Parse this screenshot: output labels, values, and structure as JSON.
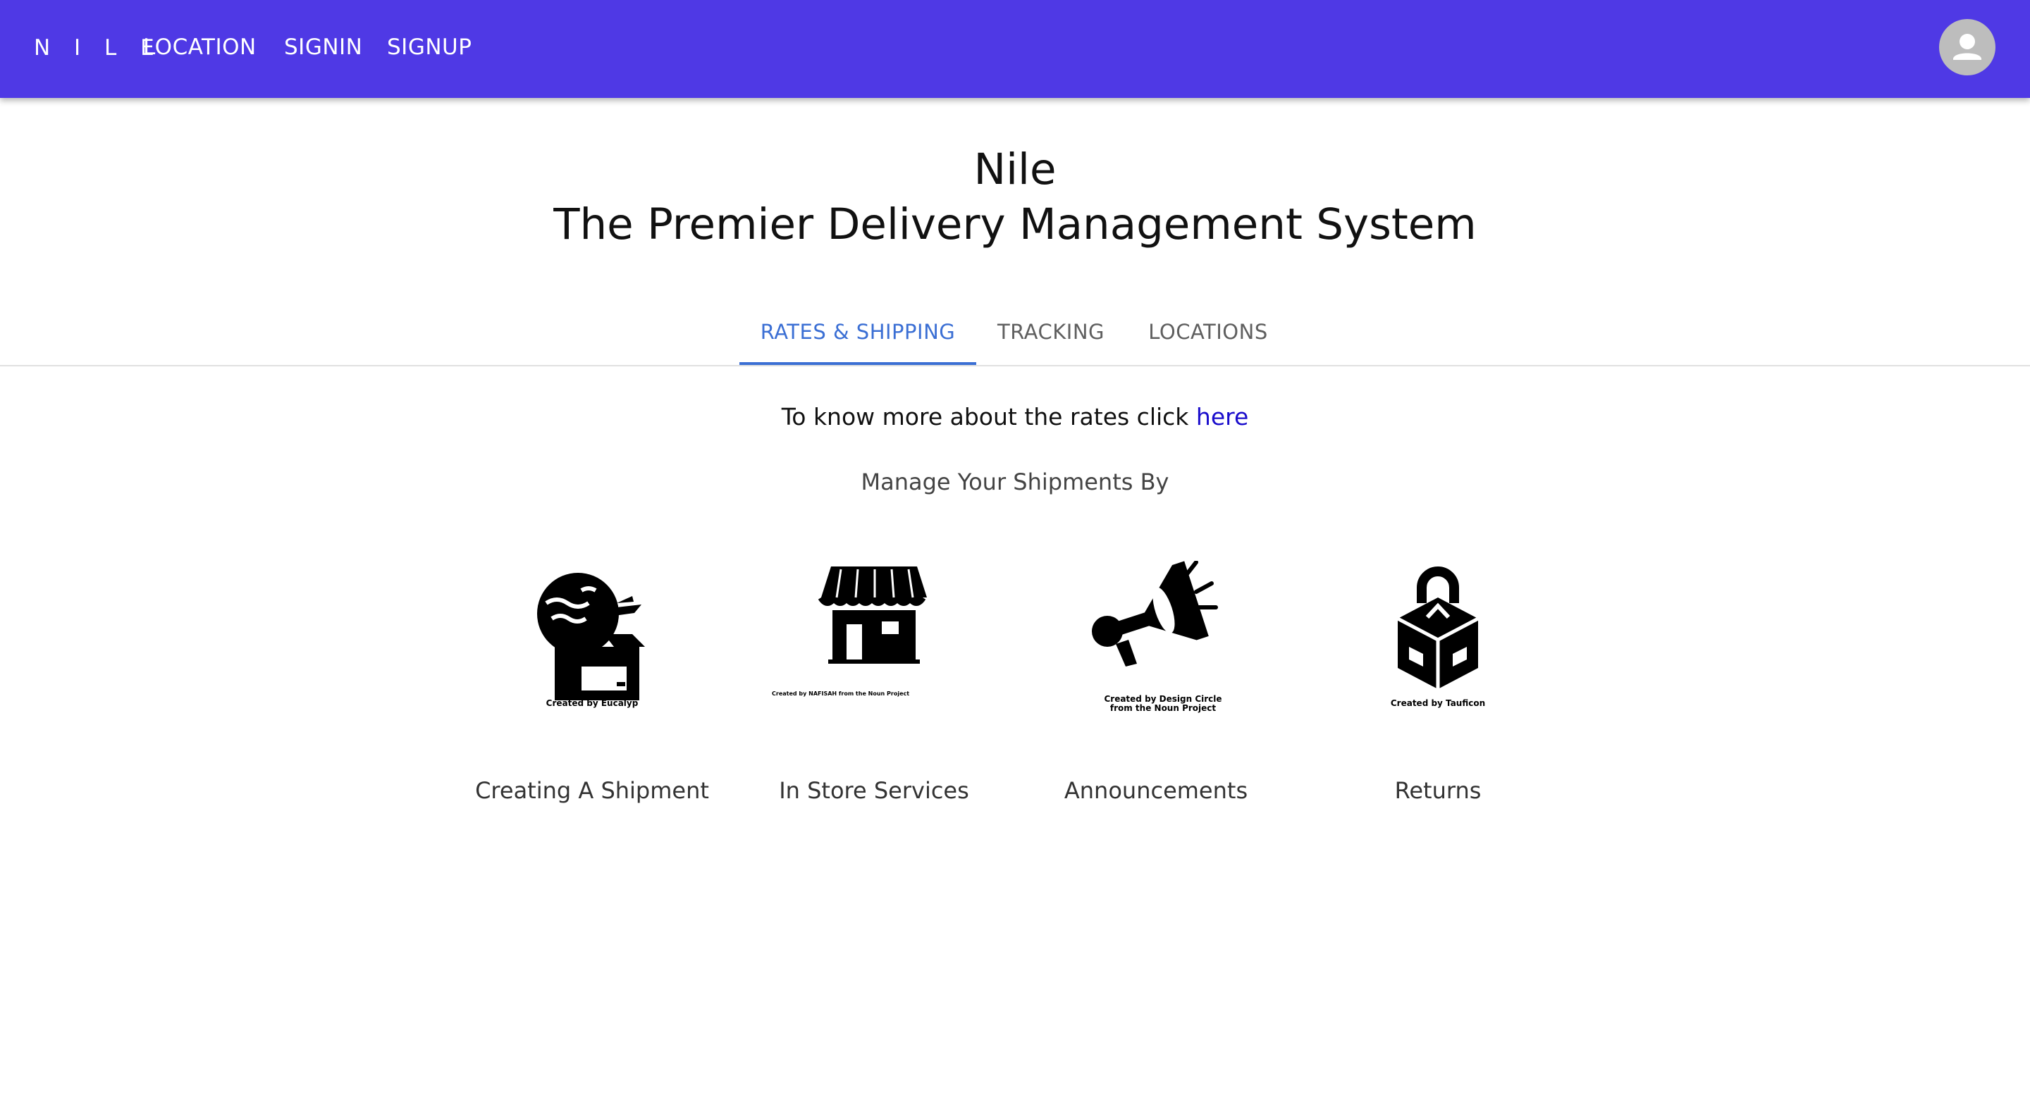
{
  "appbar": {
    "brand": "N I L E",
    "nav": [
      {
        "label": "LOCATION"
      },
      {
        "label": "SIGNIN"
      },
      {
        "label": "SIGNUP"
      }
    ],
    "avatar_icon": "account-circle-icon",
    "color": "#4f39e5"
  },
  "hero": {
    "title": "Nile",
    "subtitle": "The Premier Delivery Management System"
  },
  "tabs": {
    "items": [
      {
        "label": "RATES & SHIPPING",
        "active": true
      },
      {
        "label": "TRACKING",
        "active": false
      },
      {
        "label": "LOCATIONS",
        "active": false
      }
    ],
    "accent": "#3b6fd4"
  },
  "rates": {
    "text": "To know more about the rates click ",
    "link": "here"
  },
  "manage": {
    "heading": "Manage Your Shipments By",
    "cards": [
      {
        "label": "Creating A Shipment",
        "credit": "Created by Eucalyp",
        "icon": "box-delivery-icon"
      },
      {
        "label": "In Store Services",
        "credit": "Created by NAFISAH from the Noun Project",
        "icon": "store-icon"
      },
      {
        "label": "Announcements",
        "credit": "Created by Design Circle from the Noun Project",
        "icon": "megaphone-icon"
      },
      {
        "label": "Returns",
        "credit": "Created by Tauficon",
        "icon": "return-package-icon"
      }
    ]
  }
}
